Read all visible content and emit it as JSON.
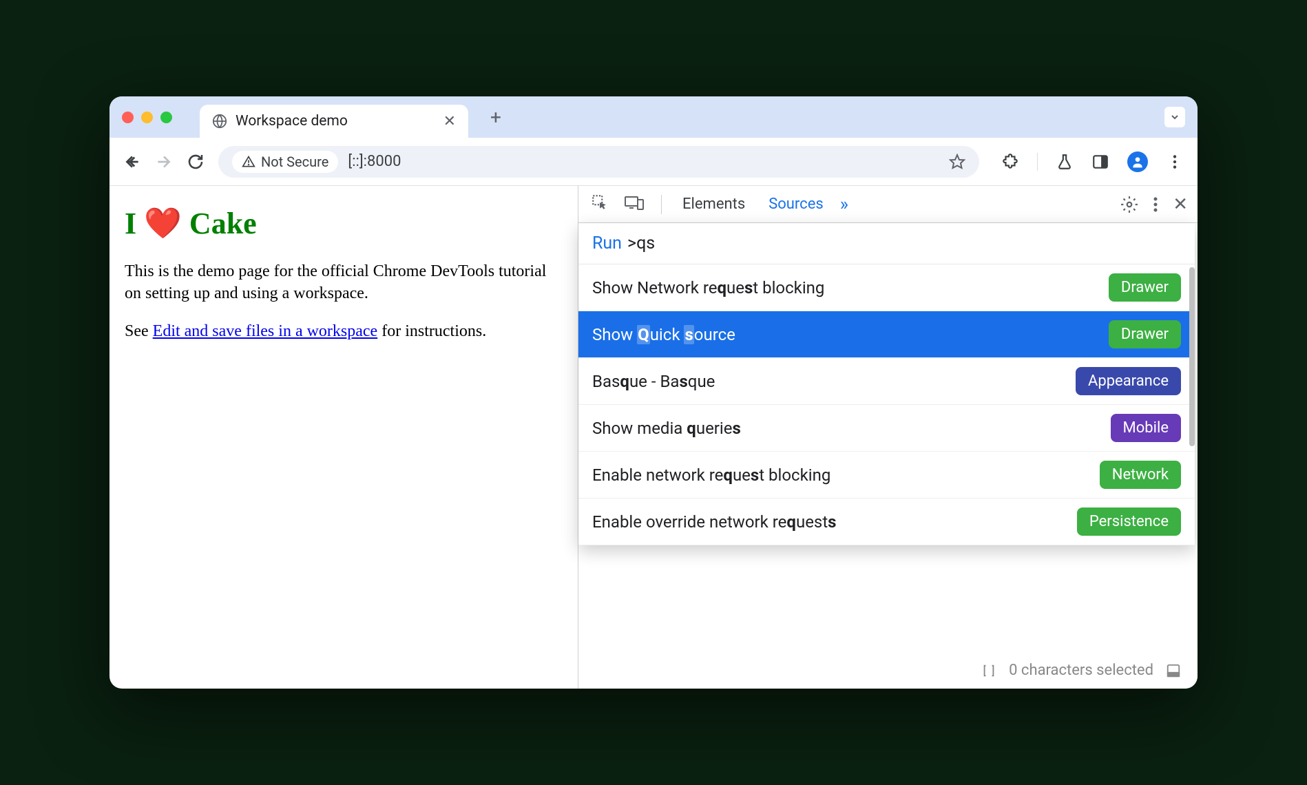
{
  "browser": {
    "tab_title": "Workspace demo",
    "not_secure_label": "Not Secure",
    "url": "[::]:8000"
  },
  "page": {
    "heading_prefix": "I ",
    "heading_heart": "❤️",
    "heading_suffix": " Cake",
    "p1": "This is the demo page for the official Chrome DevTools tutorial on setting up and using a workspace.",
    "p2_prefix": "See ",
    "p2_link": "Edit and save files in a workspace",
    "p2_suffix": " for instructions."
  },
  "devtools": {
    "tabs": {
      "elements": "Elements",
      "sources": "Sources"
    },
    "command": {
      "run_label": "Run",
      "query": ">qs",
      "items": [
        {
          "label_html": "Show Network re<b>q</b>ue<b>s</b>t blocking",
          "badge": "Drawer",
          "badge_color": "green"
        },
        {
          "label_html": "Show <span class='hl'><b>Q</b></span>uick <span class='hl'><b>s</b></span>ource",
          "badge": "Drawer",
          "badge_color": "green",
          "selected": true
        },
        {
          "label_html": "Bas<b>q</b>ue - Ba<b>s</b>que",
          "badge": "Appearance",
          "badge_color": "blue"
        },
        {
          "label_html": "Show media <b>q</b>uerie<b>s</b>",
          "badge": "Mobile",
          "badge_color": "purple"
        },
        {
          "label_html": "Enable network re<b>q</b>ue<b>s</b>t blocking",
          "badge": "Network",
          "badge_color": "green"
        },
        {
          "label_html": "Enable override network re<b>q</b>uest<b>s</b>",
          "badge": "Persistence",
          "badge_color": "green"
        }
      ]
    },
    "status": "0 characters selected"
  }
}
